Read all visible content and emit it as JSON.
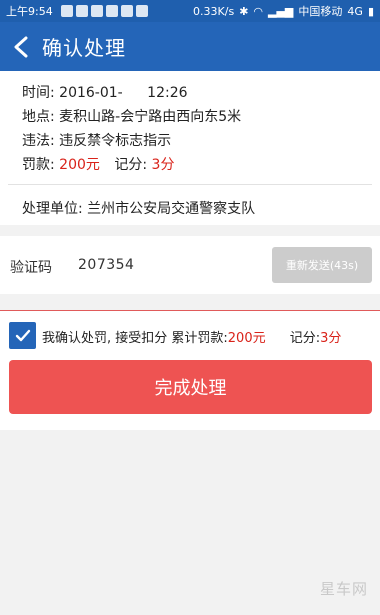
{
  "status_bar": {
    "time": "上午9:54",
    "speed": "0.33K/s",
    "carrier": "中国移动",
    "network": "4G"
  },
  "app_bar": {
    "title": "确认处理"
  },
  "info": {
    "time_label": "时间:",
    "time_value": "2016-01-",
    "time_clock": "12:26",
    "place_label": "地点:",
    "place_value": "麦积山路-会宁路由西向东5米",
    "violation_label": "违法:",
    "violation_value": "违反禁令标志指示",
    "fine_label": "罚款:",
    "fine_value": "200元",
    "points_label": "记分:",
    "points_value": "3分",
    "unit_label": "处理单位:",
    "unit_value": "兰州市公安局交通警察支队"
  },
  "verify": {
    "label": "验证码",
    "value": "207354",
    "resend_label": "重新发送(43s)"
  },
  "confirm": {
    "text_prefix": "我确认处罚, 接受扣分 累计罚款:",
    "fine": "200元",
    "points_label": "记分:",
    "points": "3分",
    "checked": true,
    "finish_label": "完成处理"
  },
  "watermark": "星车网",
  "colors": {
    "brand_blue": "#2465b8",
    "accent_red": "#ee5352",
    "disabled_gray": "#cccccc",
    "value_red": "#d9231a"
  }
}
